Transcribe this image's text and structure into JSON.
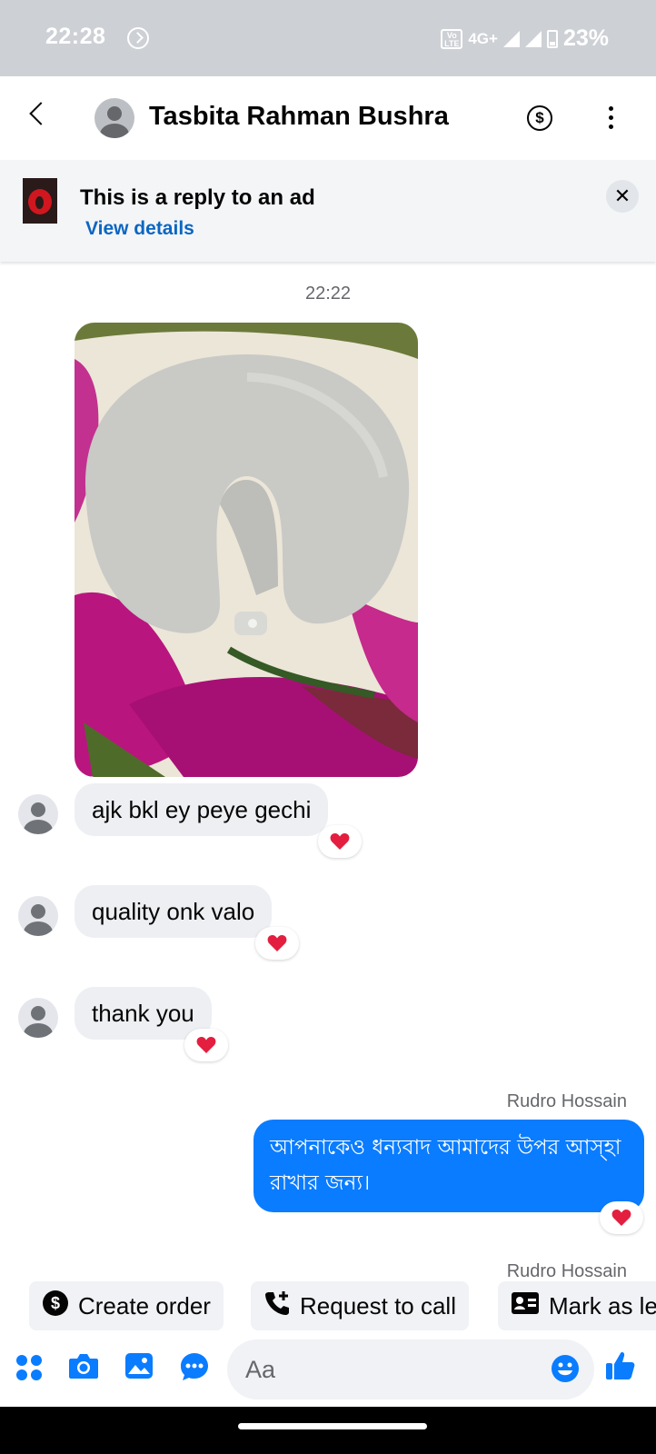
{
  "status_bar": {
    "time": "22:28",
    "network": "4G+",
    "volte": "Vo LTE",
    "battery": "23%"
  },
  "header": {
    "contact_name": "Tasbita Rahman Bushra",
    "payment_icon": "dollar-circle-icon",
    "more_icon": "more-vertical-icon",
    "back_icon": "chevron-left-icon"
  },
  "ad_banner": {
    "title": "This is a reply to an ad",
    "link": "View details",
    "close_label": "✕"
  },
  "chat": {
    "timestamp": "22:22",
    "incoming": [
      {
        "text": "ajk bkl ey peye gechi",
        "reaction": "heart"
      },
      {
        "text": "quality onk valo",
        "reaction": "heart"
      },
      {
        "text": "thank you",
        "reaction": "heart"
      }
    ],
    "outgoing": {
      "sender": "Rudro Hossain",
      "text": "আপনাকেও ধন্যবাদ আমাদের উপর আস্হা রাখার জন্য।",
      "reaction": "heart"
    },
    "next_sender": "Rudro Hossain"
  },
  "quick_actions": [
    {
      "label": "Create order",
      "icon": "dollar-circle-icon"
    },
    {
      "label": "Request to call",
      "icon": "phone-plus-icon"
    },
    {
      "label": "Mark as lead",
      "icon": "contact-card-icon"
    }
  ],
  "composer": {
    "placeholder": "Aa",
    "icons": [
      "apps-icon",
      "camera-icon",
      "gallery-icon",
      "chat-more-icon",
      "emoji-icon",
      "thumbs-up-icon"
    ]
  },
  "colors": {
    "accent": "#0a7cff",
    "link": "#0a66c2",
    "incoming_bubble": "#eeeff2",
    "reaction": "#e41e3f"
  }
}
